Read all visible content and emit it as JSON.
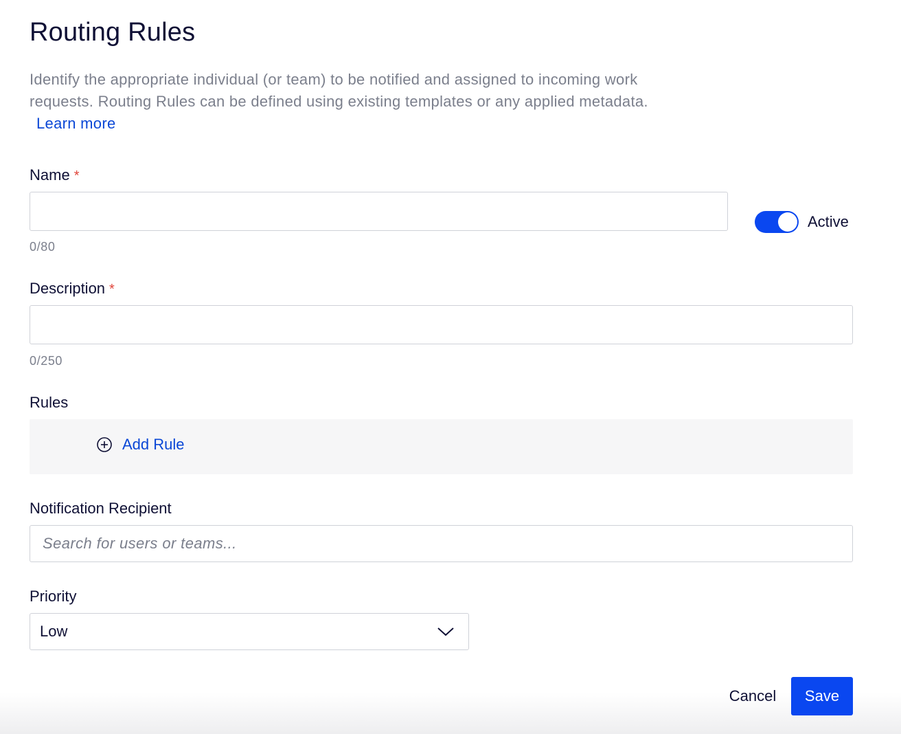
{
  "page": {
    "title": "Routing Rules",
    "intro": "Identify the appropriate individual (or team) to be notified and assigned to incoming work requests. Routing Rules can be defined using existing templates or any applied metadata.",
    "learn_more": "Learn more"
  },
  "form": {
    "name": {
      "label": "Name",
      "required_mark": "*",
      "value": "",
      "counter": "0/80"
    },
    "active": {
      "label": "Active",
      "checked": true
    },
    "description": {
      "label": "Description",
      "required_mark": "*",
      "value": "",
      "counter": "0/250"
    },
    "rules": {
      "label": "Rules",
      "add_rule_label": "Add Rule",
      "add_icon": "plus-circle-icon"
    },
    "recipient": {
      "label": "Notification Recipient",
      "placeholder": "Search for users or teams..."
    },
    "priority": {
      "label": "Priority",
      "selected": "Low",
      "icon": "chevron-down-icon"
    }
  },
  "actions": {
    "cancel_label": "Cancel",
    "save_label": "Save"
  },
  "colors": {
    "accent": "#0a47f0",
    "link": "#0a47d6",
    "required": "#e0453a",
    "text": "#0f1035",
    "muted": "#7b7f8c"
  }
}
